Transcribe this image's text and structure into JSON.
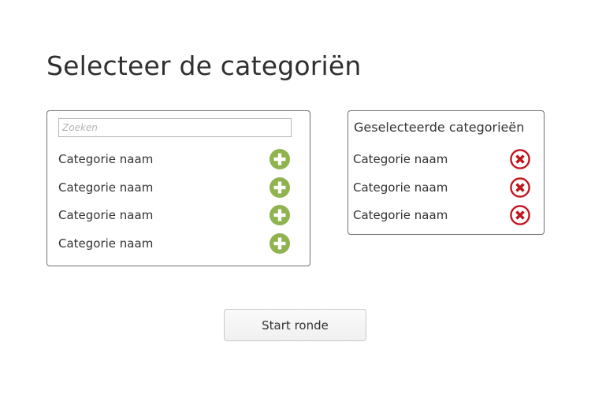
{
  "page": {
    "title": "Selecteer de categoriën"
  },
  "available": {
    "search": {
      "placeholder": "Zoeken",
      "value": ""
    },
    "items": [
      {
        "label": "Categorie naam",
        "icon": "plus-circle-icon"
      },
      {
        "label": "Categorie naam",
        "icon": "plus-circle-icon"
      },
      {
        "label": "Categorie naam",
        "icon": "plus-circle-icon"
      },
      {
        "label": "Categorie naam",
        "icon": "plus-circle-icon"
      }
    ]
  },
  "selected": {
    "header": "Geselecteerde categorieën",
    "items": [
      {
        "label": "Categorie naam",
        "icon": "remove-circle-icon"
      },
      {
        "label": "Categorie naam",
        "icon": "remove-circle-icon"
      },
      {
        "label": "Categorie naam",
        "icon": "remove-circle-icon"
      }
    ]
  },
  "actions": {
    "start_label": "Start ronde"
  },
  "colors": {
    "add_icon": "#8fb34f",
    "remove_icon": "#c0161f",
    "panel_border": "#707070",
    "text": "#333333"
  }
}
